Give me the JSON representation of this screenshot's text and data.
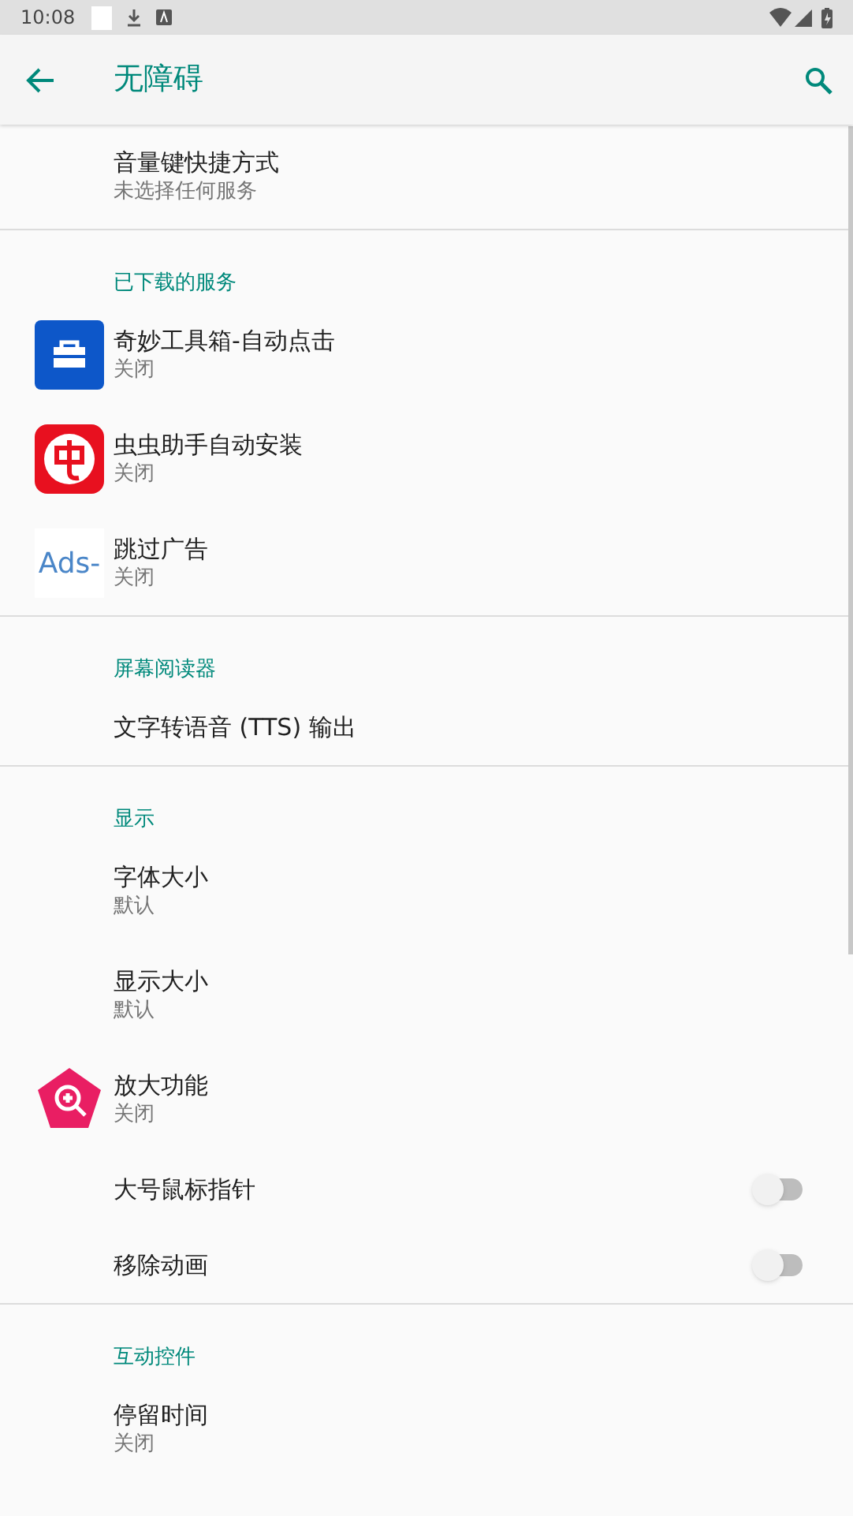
{
  "status_bar": {
    "time": "10:08"
  },
  "toolbar": {
    "title": "无障碍"
  },
  "sections": [
    {
      "items": [
        {
          "kind": "plain",
          "title": "音量键快捷方式",
          "summary": "未选择任何服务"
        }
      ]
    },
    {
      "header": "已下载的服务",
      "items": [
        {
          "kind": "app",
          "title": "奇妙工具箱-自动点击",
          "summary": "关闭"
        },
        {
          "kind": "app",
          "title": "虫虫助手自动安装",
          "summary": "关闭"
        },
        {
          "kind": "app",
          "title": "跳过广告",
          "summary": "关闭",
          "logo_text": "Ads-"
        }
      ]
    },
    {
      "header": "屏幕阅读器",
      "items": [
        {
          "kind": "plain",
          "title": "文字转语音 (TTS) 输出"
        }
      ]
    },
    {
      "header": "显示",
      "items": [
        {
          "kind": "plain",
          "title": "字体大小",
          "summary": "默认"
        },
        {
          "kind": "plain",
          "title": "显示大小",
          "summary": "默认"
        },
        {
          "kind": "app",
          "title": "放大功能",
          "summary": "关闭"
        },
        {
          "kind": "switch",
          "title": "大号鼠标指针",
          "on": false
        },
        {
          "kind": "switch",
          "title": "移除动画",
          "on": false
        }
      ]
    },
    {
      "header": "互动控件",
      "items": [
        {
          "kind": "plain",
          "title": "停留时间",
          "summary": "关闭"
        }
      ]
    }
  ]
}
